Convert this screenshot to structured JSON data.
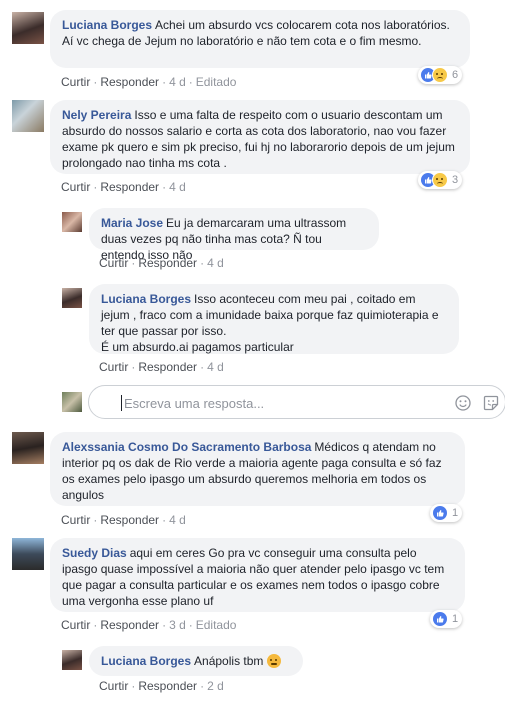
{
  "comments": [
    {
      "author": "Luciana Borges",
      "text": "Achei um absurdo vcs colocarem cota nos laboratórios.\nAí vc chega de Jejum no laboratório e não tem cota e o fim mesmo.",
      "actions": {
        "like": "Curtir",
        "reply": "Responder",
        "time": "4 d",
        "edited": "Editado"
      },
      "reaction_count": "6"
    },
    {
      "author": "Nely Pereira",
      "text": "Isso e uma falta de respeito com o usuario descontam um absurdo do nossos salario e corta as cota dos laboratorio, nao vou fazer exame pk quero e sim pk preciso, fui hj no laborarorio depois de um jejum prolongado nao tinha ms cota .",
      "actions": {
        "like": "Curtir",
        "reply": "Responder",
        "time": "4 d"
      },
      "reaction_count": "3"
    },
    {
      "author": "Alexssania Cosmo Do Sacramento Barbosa",
      "text": "Médicos q atendam no interior pq os dak de Rio verde a maioria agente paga consulta e só faz os exames pelo ipasgo um absurdo queremos melhoria em todos os angulos",
      "actions": {
        "like": "Curtir",
        "reply": "Responder",
        "time": "4 d"
      },
      "reaction_count": "1"
    },
    {
      "author": "Suedy Dias",
      "text": "aqui em ceres Go pra vc conseguir uma consulta pelo ipasgo quase impossível a maioria não quer atender pelo ipasgo vc tem que pagar a consulta particular e os exames nem todos o ipasgo cobre uma vergonha esse plano uf",
      "actions": {
        "like": "Curtir",
        "reply": "Responder",
        "time": "3 d",
        "edited": "Editado"
      },
      "reaction_count": "1"
    }
  ],
  "replies": [
    {
      "author": "Maria Jose",
      "text": "Eu ja demarcaram uma ultrassom duas vezes pq não tinha mas cota? Ñ tou entendo isso não",
      "actions": {
        "like": "Curtir",
        "reply": "Responder",
        "time": "4 d"
      }
    },
    {
      "author": "Luciana Borges",
      "text": "Isso aconteceu com meu pai , coitado em jejum , fraco com a imunidade baixa porque faz quimioterapia e ter que passar por isso.\nÉ um absurdo.ai pagamos particular",
      "actions": {
        "like": "Curtir",
        "reply": "Responder",
        "time": "4 d"
      }
    },
    {
      "author": "Luciana Borges",
      "text": "Anápolis tbm",
      "actions": {
        "like": "Curtir",
        "reply": "Responder",
        "time": "2 d"
      }
    }
  ],
  "reply_box": {
    "placeholder": "Escreva uma resposta..."
  },
  "dot": "·",
  "colors": {
    "link": "#385898",
    "bubble": "#f2f3f5",
    "like": "#4b7bec",
    "border": "#ccd0d5"
  }
}
